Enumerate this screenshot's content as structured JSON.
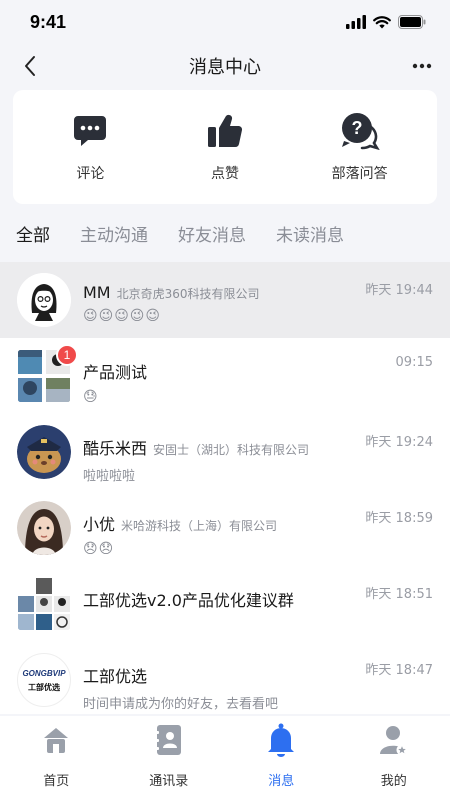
{
  "status_bar": {
    "time": "9:41"
  },
  "header": {
    "title": "消息中心"
  },
  "quick_actions": [
    {
      "label": "评论",
      "icon": "comment-bubble-icon"
    },
    {
      "label": "点赞",
      "icon": "thumbs-up-icon"
    },
    {
      "label": "部落问答",
      "icon": "question-bubble-icon"
    }
  ],
  "tabs": [
    {
      "label": "全部",
      "active": true
    },
    {
      "label": "主动沟通",
      "active": false
    },
    {
      "label": "好友消息",
      "active": false
    },
    {
      "label": "未读消息",
      "active": false
    }
  ],
  "messages": [
    {
      "name": "MM",
      "company": "北京奇虎360科技有限公司",
      "preview": "😉😉😉😉😉",
      "time": "昨天 19:44",
      "highlight": true
    },
    {
      "name": "产品测试",
      "company": "",
      "preview": "😓",
      "time": "09:15",
      "badge": "1"
    },
    {
      "name": "酷乐米西",
      "company": "安固士（湖北）科技有限公司",
      "preview": "啦啦啦啦",
      "time": "昨天 19:24"
    },
    {
      "name": "小优",
      "company": "米哈游科技（上海）有限公司",
      "preview": "😞😞",
      "time": "昨天 18:59"
    },
    {
      "name": "工部优选v2.0产品优化建议群",
      "company": "",
      "preview": "",
      "time": "昨天 18:51"
    },
    {
      "name": "工部优选",
      "company": "",
      "preview": "时间申请成为你的好友，去看看吧",
      "time": "昨天 18:47",
      "avatar_text": "GONGBVIP",
      "avatar_subtext": "工部优选"
    }
  ],
  "bottom_tabs": [
    {
      "label": "首页",
      "icon": "home-icon",
      "active": false
    },
    {
      "label": "通讯录",
      "icon": "contacts-icon",
      "active": false
    },
    {
      "label": "消息",
      "icon": "bell-icon",
      "active": true
    },
    {
      "label": "我的",
      "icon": "profile-icon",
      "active": false
    }
  ],
  "colors": {
    "accent": "#2d6ff0",
    "badge": "#f04a4a",
    "icon_gray": "#9aa0aa",
    "dark_icon": "#2b2f38"
  }
}
